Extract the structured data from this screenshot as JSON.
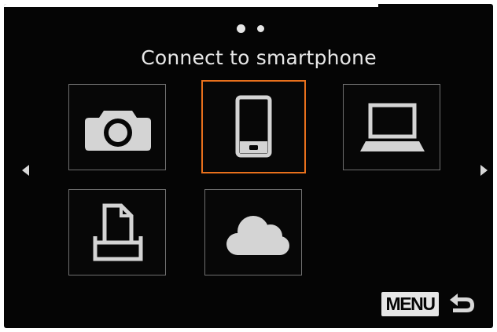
{
  "screen": {
    "title": "Connect to smartphone",
    "page_indicator": {
      "current": 1,
      "total": 2
    }
  },
  "tiles": [
    {
      "name": "camera",
      "icon": "camera-icon",
      "selected": false
    },
    {
      "name": "smartphone",
      "icon": "smartphone-icon",
      "selected": true
    },
    {
      "name": "computer",
      "icon": "laptop-icon",
      "selected": false
    },
    {
      "name": "printer",
      "icon": "printer-icon",
      "selected": false
    },
    {
      "name": "web-service",
      "icon": "cloud-icon",
      "selected": false
    }
  ],
  "navigation": {
    "prev_icon": "left-arrow-icon",
    "next_icon": "right-arrow-icon"
  },
  "footer": {
    "menu_label": "MENU",
    "back_icon": "return-arrow-icon"
  },
  "colors": {
    "background": "#050505",
    "selection": "#e8701c",
    "tile_border": "#6f6f6f",
    "icon": "#d4d4d4"
  }
}
